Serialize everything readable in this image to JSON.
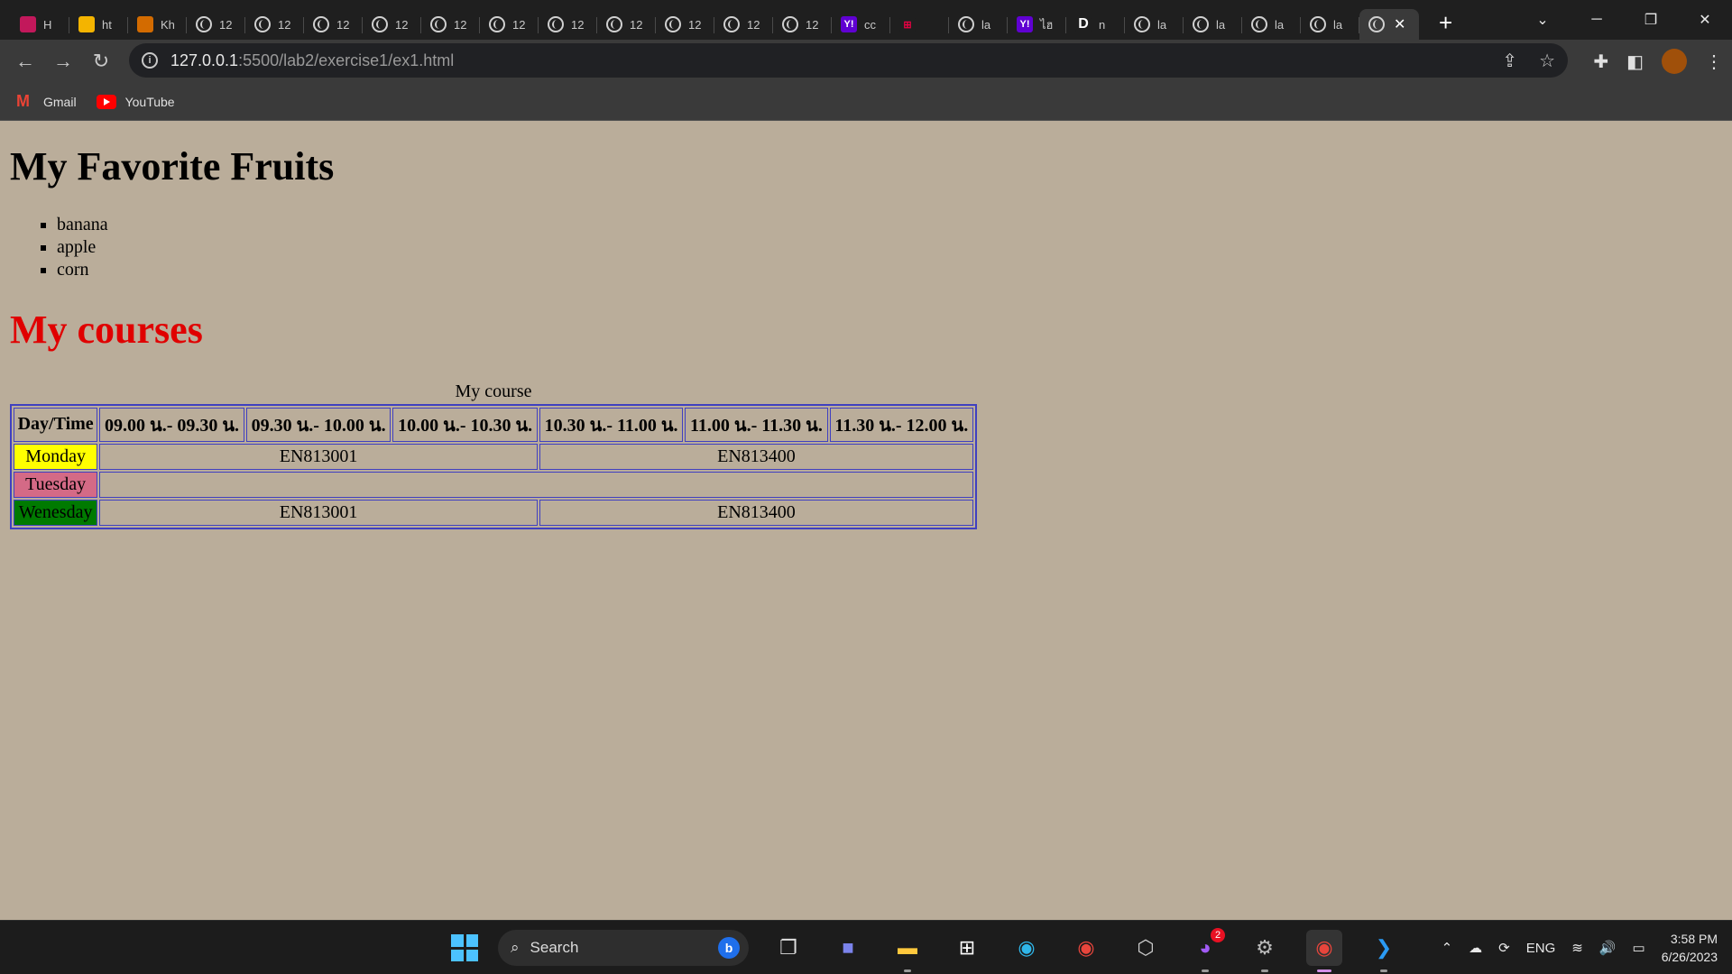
{
  "browser": {
    "tabs": [
      {
        "label": "H",
        "icon": "profile-icon",
        "color": "#c2185b"
      },
      {
        "label": "ht",
        "icon": "slides-icon",
        "color": "#f4b400"
      },
      {
        "label": "Kh",
        "icon": "flame-icon",
        "color": "#d36b00"
      },
      {
        "label": "12",
        "icon": "globe-icon"
      },
      {
        "label": "12",
        "icon": "globe-icon"
      },
      {
        "label": "12",
        "icon": "globe-icon"
      },
      {
        "label": "12",
        "icon": "globe-icon"
      },
      {
        "label": "12",
        "icon": "globe-icon"
      },
      {
        "label": "12",
        "icon": "globe-icon"
      },
      {
        "label": "12",
        "icon": "globe-icon"
      },
      {
        "label": "12",
        "icon": "globe-icon"
      },
      {
        "label": "12",
        "icon": "globe-icon"
      },
      {
        "label": "12",
        "icon": "globe-icon"
      },
      {
        "label": "12",
        "icon": "globe-icon"
      },
      {
        "label": "cc",
        "icon": "yahoo-icon",
        "color": "#6001d2"
      },
      {
        "label": "",
        "icon": "grid-icon",
        "color": "#1f1f1f"
      },
      {
        "label": "la",
        "icon": "globe-icon"
      },
      {
        "label": "ไฮ",
        "icon": "yahoo-icon",
        "color": "#6001d2"
      },
      {
        "label": "n",
        "icon": "d-icon",
        "color": "#1f1f1f"
      },
      {
        "label": "la",
        "icon": "globe-icon"
      },
      {
        "label": "la",
        "icon": "globe-icon"
      },
      {
        "label": "la",
        "icon": "globe-icon"
      },
      {
        "label": "la",
        "icon": "globe-icon"
      }
    ],
    "url_host": "127.0.0.1",
    "url_rest": ":5500/lab2/exercise1/ex1.html",
    "bookmarks": [
      {
        "label": "Gmail",
        "icon": "gmail-icon"
      },
      {
        "label": "YouTube",
        "icon": "youtube-icon"
      }
    ]
  },
  "page": {
    "title_fruits": "My Favorite Fruits",
    "fruits": [
      "banana",
      "apple",
      "corn"
    ],
    "title_courses": "My courses",
    "table": {
      "caption": "My course",
      "headers": [
        "Day/Time",
        "09.00 น.- 09.30 น.",
        "09.30 น.- 10.00 น.",
        "10.00 น.- 10.30 น.",
        "10.30 น.- 11.00 น.",
        "11.00 น.- 11.30 น.",
        "11.30 น.- 12.00 น."
      ],
      "rows": [
        {
          "day": "Monday",
          "color": "#ffff00",
          "course1": "EN813001",
          "course2": "EN813400"
        },
        {
          "day": "Tuesday",
          "color": "#d46a86",
          "course1": "",
          "course2": ""
        },
        {
          "day": "Wenesday",
          "color": "#007a00",
          "course1": "EN813001",
          "course2": "EN813400"
        }
      ]
    }
  },
  "taskbar": {
    "search_label": "Search",
    "messenger_badge": "2",
    "language": "ENG",
    "time": "3:58 PM",
    "date": "6/26/2023"
  }
}
